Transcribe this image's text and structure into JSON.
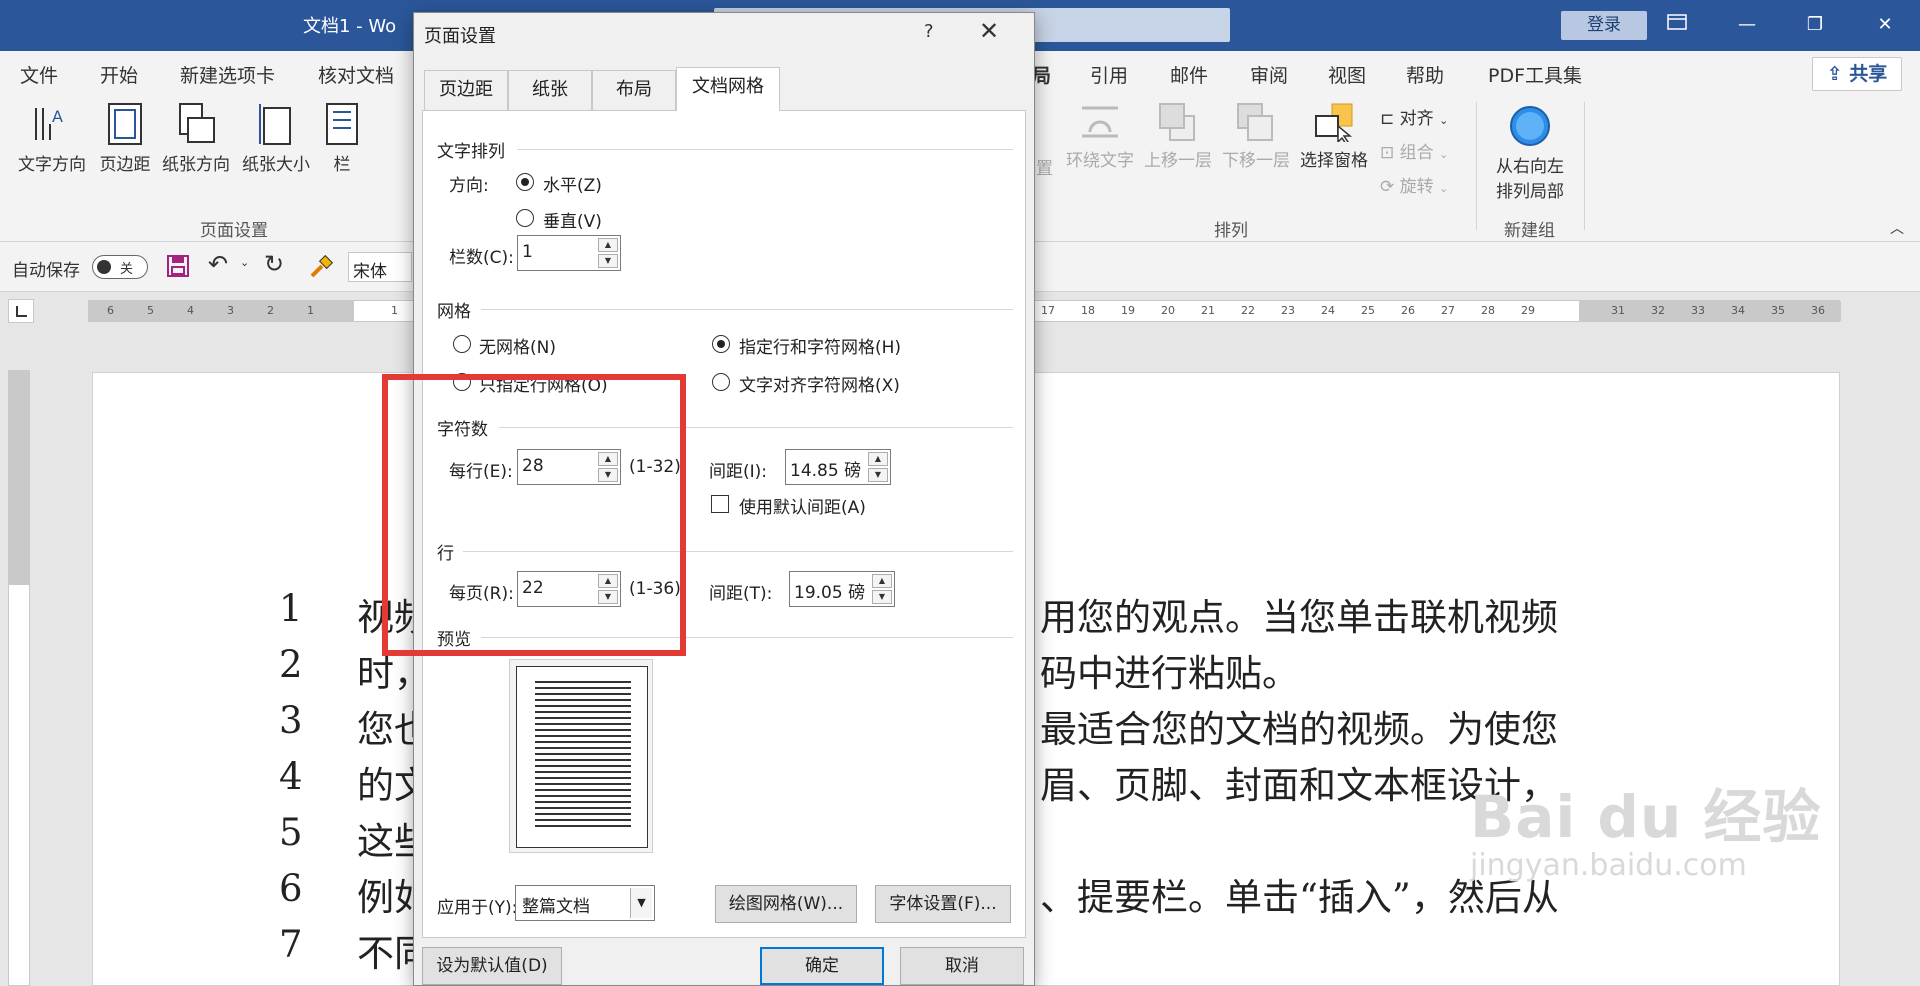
{
  "titlebar": {
    "doc_title": "文档1  -  Wo",
    "login": "登录",
    "restore_ribbon_icon": "ribbon-display-icon",
    "minimize": "—",
    "maximize": "❐",
    "close": "✕"
  },
  "ribbon_tabs": {
    "file": "文件",
    "home": "开始",
    "new_tab": "新建选项卡",
    "proof": "核对文档",
    "layout_partial": "局",
    "references": "引用",
    "mailings": "邮件",
    "review": "审阅",
    "view": "视图",
    "help": "帮助",
    "pdf": "PDF工具集",
    "share": "共享"
  },
  "ribbon": {
    "text_direction": "文字方向",
    "margins": "页边距",
    "orientation": "纸张方向",
    "size": "纸张大小",
    "columns": "栏",
    "page_setup_group": "页面设置",
    "position_partial": "置",
    "wrap_text": "环绕文字",
    "bring_forward": "上移一层",
    "send_backward": "下移一层",
    "selection_pane": "选择窗格",
    "align": "对齐",
    "group": "组合",
    "rotate": "旋转",
    "arrange_group": "排列",
    "rtl_line1": "从右向左",
    "rtl_line2": "排列局部",
    "new_group": "新建组"
  },
  "qat": {
    "autosave": "自动保存",
    "autosave_state": "关",
    "font": "宋体"
  },
  "ruler": {
    "left_numbers": [
      "6",
      "5",
      "4",
      "3",
      "2",
      "1",
      "1"
    ],
    "right_numbers": [
      "17",
      "18",
      "19",
      "20",
      "21",
      "22",
      "23",
      "24",
      "25",
      "26",
      "27",
      "28",
      "29",
      "31",
      "32",
      "33",
      "34",
      "35",
      "36"
    ]
  },
  "document": {
    "lines": [
      {
        "num": "1",
        "t1": "视频",
        "t2": "用您的观点。当您单击联机视频"
      },
      {
        "num": "2",
        "t1": "时，",
        "t2": "码中进行粘贴。"
      },
      {
        "num": "3",
        "t1": "您也",
        "t2": "最适合您的文档的视频。为使您"
      },
      {
        "num": "4",
        "t1": "的文",
        "t2": "眉、页脚、封面和文本框设计，"
      },
      {
        "num": "5",
        "t1": "这些",
        "t2": ""
      },
      {
        "num": "6",
        "t1": "例如",
        "t2": "、提要栏。单击“插入”，然后从"
      },
      {
        "num": "7",
        "t1": "不同",
        "t2": ""
      }
    ]
  },
  "watermark": {
    "brand": "Bai  du 经验",
    "url": "jingyan.baidu.com"
  },
  "dialog": {
    "title": "页面设置",
    "help": "?",
    "close": "✕",
    "tabs": [
      "页边距",
      "纸张",
      "布局",
      "文档网格"
    ],
    "text_layout": {
      "title": "文字排列",
      "direction_label": "方向:",
      "horizontal": "水平(Z)",
      "vertical": "垂直(V)",
      "columns_label": "栏数(C):",
      "columns_value": "1"
    },
    "grid": {
      "title": "网格",
      "no_grid": "无网格(N)",
      "line_grid_only": "只指定行网格(O)",
      "line_and_char_grid": "指定行和字符网格(H)",
      "snap_to_char": "文字对齐字符网格(X)"
    },
    "characters": {
      "title": "字符数",
      "per_line_label": "每行(E):",
      "per_line_value": "28",
      "per_line_range": "(1-32)",
      "pitch_label": "间距(I):",
      "pitch_value": "14.85 磅",
      "default_pitch": "使用默认间距(A)"
    },
    "lines": {
      "title": "行",
      "per_page_label": "每页(R):",
      "per_page_value": "22",
      "per_page_range": "(1-36)",
      "pitch_label": "间距(T):",
      "pitch_value": "19.05 磅"
    },
    "preview_title": "预览",
    "apply_to_label": "应用于(Y):",
    "apply_to_value": "整篇文档",
    "drawing_grid": "绘图网格(W)...",
    "font_settings": "字体设置(F)...",
    "set_default": "设为默认值(D)",
    "ok": "确定",
    "cancel": "取消"
  },
  "colors": {
    "titlebar": "#2b579a",
    "highlight": "#e53935",
    "primary_button_border": "#0078d7"
  }
}
